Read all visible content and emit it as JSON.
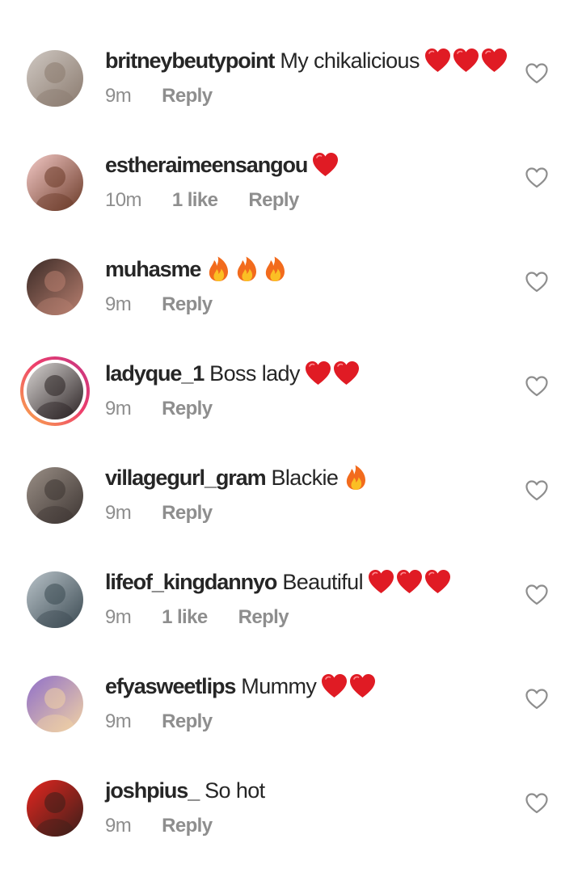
{
  "comments": [
    {
      "username": "britneybeutypoint",
      "text": "My chikalicious",
      "emojis": [
        "heart",
        "heart",
        "heart"
      ],
      "time": "9m",
      "likes": "",
      "reply": "Reply",
      "story_ring": false,
      "avatar_colors": [
        "#cfc8c2",
        "#8a7a6e"
      ]
    },
    {
      "username": "estheraimeensangou",
      "text": "",
      "emojis": [
        "heart"
      ],
      "time": "10m",
      "likes": "1 like",
      "reply": "Reply",
      "story_ring": false,
      "avatar_colors": [
        "#f3c9c6",
        "#6b3a28"
      ]
    },
    {
      "username": "muhasme",
      "text": "",
      "emojis": [
        "fire",
        "fire",
        "fire"
      ],
      "time": "9m",
      "likes": "",
      "reply": "Reply",
      "story_ring": false,
      "avatar_colors": [
        "#3a2a26",
        "#b98070"
      ]
    },
    {
      "username": "ladyque_1",
      "text": "Boss lady",
      "emojis": [
        "heart",
        "heart"
      ],
      "time": "9m",
      "likes": "",
      "reply": "Reply",
      "story_ring": true,
      "avatar_colors": [
        "#d8d4d2",
        "#2a2223"
      ]
    },
    {
      "username": "villagegurl_gram",
      "text": "Blackie",
      "emojis": [
        "fire"
      ],
      "time": "9m",
      "likes": "",
      "reply": "Reply",
      "story_ring": false,
      "avatar_colors": [
        "#9a8f86",
        "#3d3532"
      ]
    },
    {
      "username": "lifeof_kingdannyo",
      "text": "Beautiful",
      "emojis": [
        "heart",
        "heart",
        "heart"
      ],
      "time": "9m",
      "likes": "1 like",
      "reply": "Reply",
      "story_ring": false,
      "avatar_colors": [
        "#b9c3c9",
        "#3b4a52"
      ]
    },
    {
      "username": "efyasweetlips",
      "text": "Mummy",
      "emojis": [
        "heart",
        "heart"
      ],
      "time": "9m",
      "likes": "",
      "reply": "Reply",
      "story_ring": false,
      "avatar_colors": [
        "#8f6fc9",
        "#f1d2a4"
      ]
    },
    {
      "username": "joshpius_",
      "text": "So hot",
      "emojis": [],
      "time": "9m",
      "likes": "",
      "reply": "Reply",
      "story_ring": false,
      "avatar_colors": [
        "#e4261f",
        "#3b1f1a"
      ]
    }
  ],
  "colors": {
    "text": "#262626",
    "meta": "#8e8e8e",
    "heart_emoji": "#e01b24",
    "like_icon_stroke": "#8e8e8e",
    "story_ring": "#ee3e6c"
  }
}
